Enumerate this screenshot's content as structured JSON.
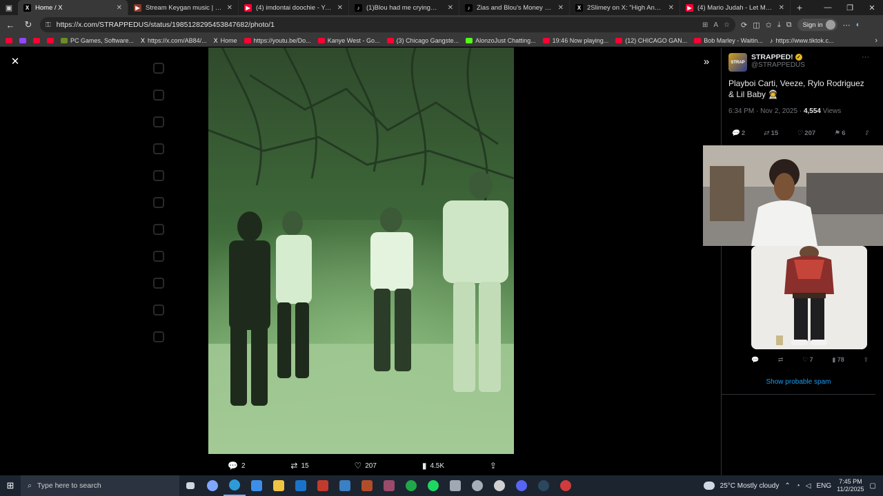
{
  "browser": {
    "tabs": [
      {
        "title": "Home / X",
        "icon": "x-icon",
        "color": "#000000",
        "active": true
      },
      {
        "title": "Stream Keygan music | Listen to s",
        "icon": "soundcloud-icon",
        "color": "#8b3a2a",
        "active": false
      },
      {
        "title": "(4) imdontai doochie - YouTube",
        "icon": "youtube-icon",
        "color": "#ff0033",
        "active": false
      },
      {
        "title": "(1)Blou had me crying😭 #plaqu",
        "icon": "tiktok-icon",
        "color": "#000000",
        "active": false
      },
      {
        "title": "Zias and Blou's Money Mishap E",
        "icon": "tiktok-icon",
        "color": "#000000",
        "active": false
      },
      {
        "title": "2Slimey on X: \"High Anxiety 11/",
        "icon": "x-icon",
        "color": "#000000",
        "active": false
      },
      {
        "title": "(4) Mario Judah - Let Me Outta H",
        "icon": "youtube-icon",
        "color": "#ff0033",
        "active": false
      }
    ],
    "url": "https://x.com/STRAPPEDUS/status/1985128295453847682/photo/1",
    "signin_label": "Sign in",
    "bookmarks": [
      {
        "label": "",
        "kind": "yt"
      },
      {
        "label": "",
        "kind": "tw"
      },
      {
        "label": "",
        "kind": "yt"
      },
      {
        "label": "",
        "kind": "yt"
      },
      {
        "label": "PC Games, Software...",
        "kind": "gen"
      },
      {
        "label": "https://x.com/AB84/...",
        "kind": "x"
      },
      {
        "label": "Home",
        "kind": "x"
      },
      {
        "label": "https://youtu.be/Do...",
        "kind": "yt"
      },
      {
        "label": "Kanye West - Go...",
        "kind": "yt"
      },
      {
        "label": "(3) Chicago Gangste...",
        "kind": "yt"
      },
      {
        "label": "AlonzoJust Chatting...",
        "kind": "kick"
      },
      {
        "label": "19:46 Now playing...",
        "kind": "yt"
      },
      {
        "label": "(12) CHICAGO GAN...",
        "kind": "yt"
      },
      {
        "label": "Bob Marley - Waitin...",
        "kind": "yt"
      },
      {
        "label": "https://www.tiktok.c...",
        "kind": "tt"
      }
    ]
  },
  "photo_actions": {
    "replies": "2",
    "reposts": "15",
    "likes": "207",
    "views": "4.5K"
  },
  "tweet": {
    "name": "STRAPPED!",
    "handle": "@STRAPPEDUS",
    "text": "Playboi Carti, Veeze, Rylo Rodriguez & Lil Baby 👨‍🚀",
    "time": "6:34 PM · Nov 2, 2025 · ",
    "views_count": "4,554",
    "views_label": " Views",
    "replies": "2",
    "reposts": "15",
    "likes": "207",
    "bookmarks": "6"
  },
  "reply": {
    "likes": "7",
    "views": "78"
  },
  "show_spam": "Show probable spam",
  "taskbar": {
    "search_placeholder": "Type here to search",
    "weather": "25°C  Mostly cloudy",
    "lang": "ENG",
    "time": "7:45 PM",
    "date": "11/2/2025"
  }
}
